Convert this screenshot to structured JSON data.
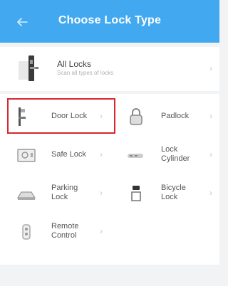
{
  "header": {
    "title": "Choose Lock Type",
    "back_icon": "arrow-left-icon"
  },
  "all_locks": {
    "title": "All Locks",
    "subtitle": "Scan all types of locks",
    "icon": "door-lock-icon"
  },
  "chevron": "›",
  "cells": [
    {
      "label": "Door Lock",
      "icon": "door-handle-icon"
    },
    {
      "label": "Padlock",
      "icon": "padlock-icon"
    },
    {
      "label": "Safe Lock",
      "icon": "safe-icon"
    },
    {
      "label": "Lock\nCylinder",
      "icon": "cylinder-icon"
    },
    {
      "label": "Parking\nLock",
      "icon": "parking-lock-icon"
    },
    {
      "label": "Bicycle\nLock",
      "icon": "bicycle-lock-icon"
    },
    {
      "label": "Remote\nControl",
      "icon": "remote-control-icon"
    }
  ],
  "highlight_color": "#d7262f",
  "accent_color": "#42a9f0"
}
